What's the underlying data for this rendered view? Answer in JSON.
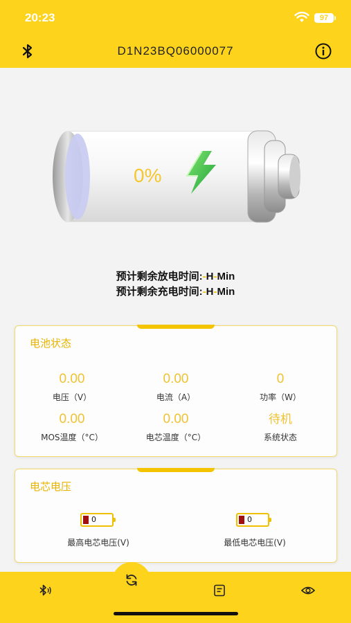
{
  "status_bar": {
    "time": "20:23",
    "battery_level": "97"
  },
  "nav": {
    "title": "D1N23BQ06000077"
  },
  "battery": {
    "percent_text": "0%",
    "fill_fraction": 0.0
  },
  "estimates": {
    "discharge": {
      "label": "预计剩余放电时间:",
      "dash1": "-",
      "h": "H",
      "dash2": "-",
      "min": "Min"
    },
    "charge": {
      "label": "预计剩余充电时间:",
      "dash1": "-",
      "h": "H",
      "dash2": "-",
      "min": "Min"
    }
  },
  "battery_status": {
    "title": "电池状态",
    "metrics": [
      {
        "value": "0.00",
        "label": "电压（V）"
      },
      {
        "value": "0.00",
        "label": "电流（A）"
      },
      {
        "value": "0",
        "label": "功率（W）"
      },
      {
        "value": "0.00",
        "label": "MOS温度（°C）"
      },
      {
        "value": "0.00",
        "label": "电芯温度（°C）"
      },
      {
        "value": "待机",
        "label": "系统状态"
      }
    ]
  },
  "cell_voltage": {
    "title": "电芯电压",
    "max": {
      "value": "0",
      "label": "最高电芯电压(V)"
    },
    "min": {
      "value": "0",
      "label": "最低电芯电压(V)"
    }
  },
  "tabbar": {
    "icons": [
      "bluetooth-icon",
      "refresh-icon",
      "list-icon",
      "eye-icon"
    ],
    "accent": "#fed31c"
  }
}
